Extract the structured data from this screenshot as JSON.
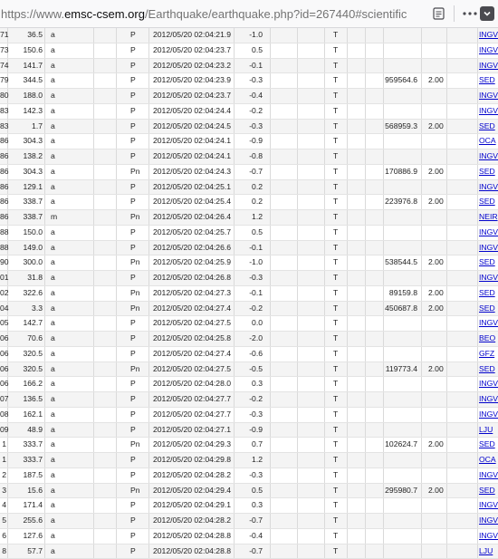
{
  "browser": {
    "url_prefix": "https://www.",
    "url_host": "emsc-csem.org",
    "url_path": "/Earthquake/earthquake.php?id=267440#scientific",
    "reader_icon": "reader-view-icon",
    "menu_icon": "more-icon",
    "pocket_icon": "pocket-icon"
  },
  "rows": [
    {
      "id": "71",
      "azimuth": "36.5",
      "flag": "a",
      "phase": "P",
      "time": "2012/05/20 02:04:21.9",
      "res": "-1.0",
      "type": "T",
      "amp": "",
      "per": "",
      "agency": "INGV"
    },
    {
      "id": "73",
      "azimuth": "150.6",
      "flag": "a",
      "phase": "P",
      "time": "2012/05/20 02:04:23.7",
      "res": "0.5",
      "type": "T",
      "amp": "",
      "per": "",
      "agency": "INGV"
    },
    {
      "id": "74",
      "azimuth": "141.7",
      "flag": "a",
      "phase": "P",
      "time": "2012/05/20 02:04:23.2",
      "res": "-0.1",
      "type": "T",
      "amp": "",
      "per": "",
      "agency": "INGV"
    },
    {
      "id": "79",
      "azimuth": "344.5",
      "flag": "a",
      "phase": "P",
      "time": "2012/05/20 02:04:23.9",
      "res": "-0.3",
      "type": "T",
      "amp": "959564.6",
      "per": "2.00",
      "agency": "SED"
    },
    {
      "id": "80",
      "azimuth": "188.0",
      "flag": "a",
      "phase": "P",
      "time": "2012/05/20 02:04:23.7",
      "res": "-0.4",
      "type": "T",
      "amp": "",
      "per": "",
      "agency": "INGV"
    },
    {
      "id": "83",
      "azimuth": "142.3",
      "flag": "a",
      "phase": "P",
      "time": "2012/05/20 02:04:24.4",
      "res": "-0.2",
      "type": "T",
      "amp": "",
      "per": "",
      "agency": "INGV"
    },
    {
      "id": "83",
      "azimuth": "1.7",
      "flag": "a",
      "phase": "P",
      "time": "2012/05/20 02:04:24.5",
      "res": "-0.3",
      "type": "T",
      "amp": "568959.3",
      "per": "2.00",
      "agency": "SED"
    },
    {
      "id": "86",
      "azimuth": "304.3",
      "flag": "a",
      "phase": "P",
      "time": "2012/05/20 02:04:24.1",
      "res": "-0.9",
      "type": "T",
      "amp": "",
      "per": "",
      "agency": "OCA"
    },
    {
      "id": "86",
      "azimuth": "138.2",
      "flag": "a",
      "phase": "P",
      "time": "2012/05/20 02:04:24.1",
      "res": "-0.8",
      "type": "T",
      "amp": "",
      "per": "",
      "agency": "INGV"
    },
    {
      "id": "86",
      "azimuth": "304.3",
      "flag": "a",
      "phase": "Pn",
      "time": "2012/05/20 02:04:24.3",
      "res": "-0.7",
      "type": "T",
      "amp": "170886.9",
      "per": "2.00",
      "agency": "SED"
    },
    {
      "id": "86",
      "azimuth": "129.1",
      "flag": "a",
      "phase": "P",
      "time": "2012/05/20 02:04:25.1",
      "res": "0.2",
      "type": "T",
      "amp": "",
      "per": "",
      "agency": "INGV"
    },
    {
      "id": "86",
      "azimuth": "338.7",
      "flag": "a",
      "phase": "P",
      "time": "2012/05/20 02:04:25.4",
      "res": "0.2",
      "type": "T",
      "amp": "223976.8",
      "per": "2.00",
      "agency": "SED"
    },
    {
      "id": "86",
      "azimuth": "338.7",
      "flag": "m",
      "phase": "Pn",
      "time": "2012/05/20 02:04:26.4",
      "res": "1.2",
      "type": "T",
      "amp": "",
      "per": "",
      "agency": "NEIR"
    },
    {
      "id": "88",
      "azimuth": "150.0",
      "flag": "a",
      "phase": "P",
      "time": "2012/05/20 02:04:25.7",
      "res": "0.5",
      "type": "T",
      "amp": "",
      "per": "",
      "agency": "INGV"
    },
    {
      "id": "88",
      "azimuth": "149.0",
      "flag": "a",
      "phase": "P",
      "time": "2012/05/20 02:04:26.6",
      "res": "-0.1",
      "type": "T",
      "amp": "",
      "per": "",
      "agency": "INGV"
    },
    {
      "id": "90",
      "azimuth": "300.0",
      "flag": "a",
      "phase": "Pn",
      "time": "2012/05/20 02:04:25.9",
      "res": "-1.0",
      "type": "T",
      "amp": "538544.5",
      "per": "2.00",
      "agency": "SED"
    },
    {
      "id": "01",
      "azimuth": "31.8",
      "flag": "a",
      "phase": "P",
      "time": "2012/05/20 02:04:26.8",
      "res": "-0.3",
      "type": "T",
      "amp": "",
      "per": "",
      "agency": "INGV"
    },
    {
      "id": "02",
      "azimuth": "322.6",
      "flag": "a",
      "phase": "Pn",
      "time": "2012/05/20 02:04:27.3",
      "res": "-0.1",
      "type": "T",
      "amp": "89159.8",
      "per": "2.00",
      "agency": "SED"
    },
    {
      "id": "04",
      "azimuth": "3.3",
      "flag": "a",
      "phase": "Pn",
      "time": "2012/05/20 02:04:27.4",
      "res": "-0.2",
      "type": "T",
      "amp": "450687.8",
      "per": "2.00",
      "agency": "SED"
    },
    {
      "id": "05",
      "azimuth": "142.7",
      "flag": "a",
      "phase": "P",
      "time": "2012/05/20 02:04:27.5",
      "res": "0.0",
      "type": "T",
      "amp": "",
      "per": "",
      "agency": "INGV"
    },
    {
      "id": "06",
      "azimuth": "70.6",
      "flag": "a",
      "phase": "P",
      "time": "2012/05/20 02:04:25.8",
      "res": "-2.0",
      "type": "T",
      "amp": "",
      "per": "",
      "agency": "BEO"
    },
    {
      "id": "06",
      "azimuth": "320.5",
      "flag": "a",
      "phase": "P",
      "time": "2012/05/20 02:04:27.4",
      "res": "-0.6",
      "type": "T",
      "amp": "",
      "per": "",
      "agency": "GFZ"
    },
    {
      "id": "06",
      "azimuth": "320.5",
      "flag": "a",
      "phase": "Pn",
      "time": "2012/05/20 02:04:27.5",
      "res": "-0.5",
      "type": "T",
      "amp": "119773.4",
      "per": "2.00",
      "agency": "SED"
    },
    {
      "id": "06",
      "azimuth": "166.2",
      "flag": "a",
      "phase": "P",
      "time": "2012/05/20 02:04:28.0",
      "res": "0.3",
      "type": "T",
      "amp": "",
      "per": "",
      "agency": "INGV"
    },
    {
      "id": "07",
      "azimuth": "136.5",
      "flag": "a",
      "phase": "P",
      "time": "2012/05/20 02:04:27.7",
      "res": "-0.2",
      "type": "T",
      "amp": "",
      "per": "",
      "agency": "INGV"
    },
    {
      "id": "08",
      "azimuth": "162.1",
      "flag": "a",
      "phase": "P",
      "time": "2012/05/20 02:04:27.7",
      "res": "-0.3",
      "type": "T",
      "amp": "",
      "per": "",
      "agency": "INGV"
    },
    {
      "id": "09",
      "azimuth": "48.9",
      "flag": "a",
      "phase": "P",
      "time": "2012/05/20 02:04:27.1",
      "res": "-0.9",
      "type": "T",
      "amp": "",
      "per": "",
      "agency": "LJU"
    },
    {
      "id": "1",
      "azimuth": "333.7",
      "flag": "a",
      "phase": "Pn",
      "time": "2012/05/20 02:04:29.3",
      "res": "0.7",
      "type": "T",
      "amp": "102624.7",
      "per": "2.00",
      "agency": "SED"
    },
    {
      "id": "1",
      "azimuth": "333.7",
      "flag": "a",
      "phase": "P",
      "time": "2012/05/20 02:04:29.8",
      "res": "1.2",
      "type": "T",
      "amp": "",
      "per": "",
      "agency": "OCA"
    },
    {
      "id": "2",
      "azimuth": "187.5",
      "flag": "a",
      "phase": "P",
      "time": "2012/05/20 02:04:28.2",
      "res": "-0.3",
      "type": "T",
      "amp": "",
      "per": "",
      "agency": "INGV"
    },
    {
      "id": "3",
      "azimuth": "15.6",
      "flag": "a",
      "phase": "Pn",
      "time": "2012/05/20 02:04:29.4",
      "res": "0.5",
      "type": "T",
      "amp": "295980.7",
      "per": "2.00",
      "agency": "SED"
    },
    {
      "id": "4",
      "azimuth": "171.4",
      "flag": "a",
      "phase": "P",
      "time": "2012/05/20 02:04:29.1",
      "res": "0.3",
      "type": "T",
      "amp": "",
      "per": "",
      "agency": "INGV"
    },
    {
      "id": "5",
      "azimuth": "255.6",
      "flag": "a",
      "phase": "P",
      "time": "2012/05/20 02:04:28.2",
      "res": "-0.7",
      "type": "T",
      "amp": "",
      "per": "",
      "agency": "INGV"
    },
    {
      "id": "6",
      "azimuth": "127.6",
      "flag": "a",
      "phase": "P",
      "time": "2012/05/20 02:04:28.8",
      "res": "-0.4",
      "type": "T",
      "amp": "",
      "per": "",
      "agency": "INGV"
    },
    {
      "id": "8",
      "azimuth": "57.7",
      "flag": "a",
      "phase": "P",
      "time": "2012/05/20 02:04:28.8",
      "res": "-0.7",
      "type": "T",
      "amp": "",
      "per": "",
      "agency": "LJU"
    }
  ]
}
